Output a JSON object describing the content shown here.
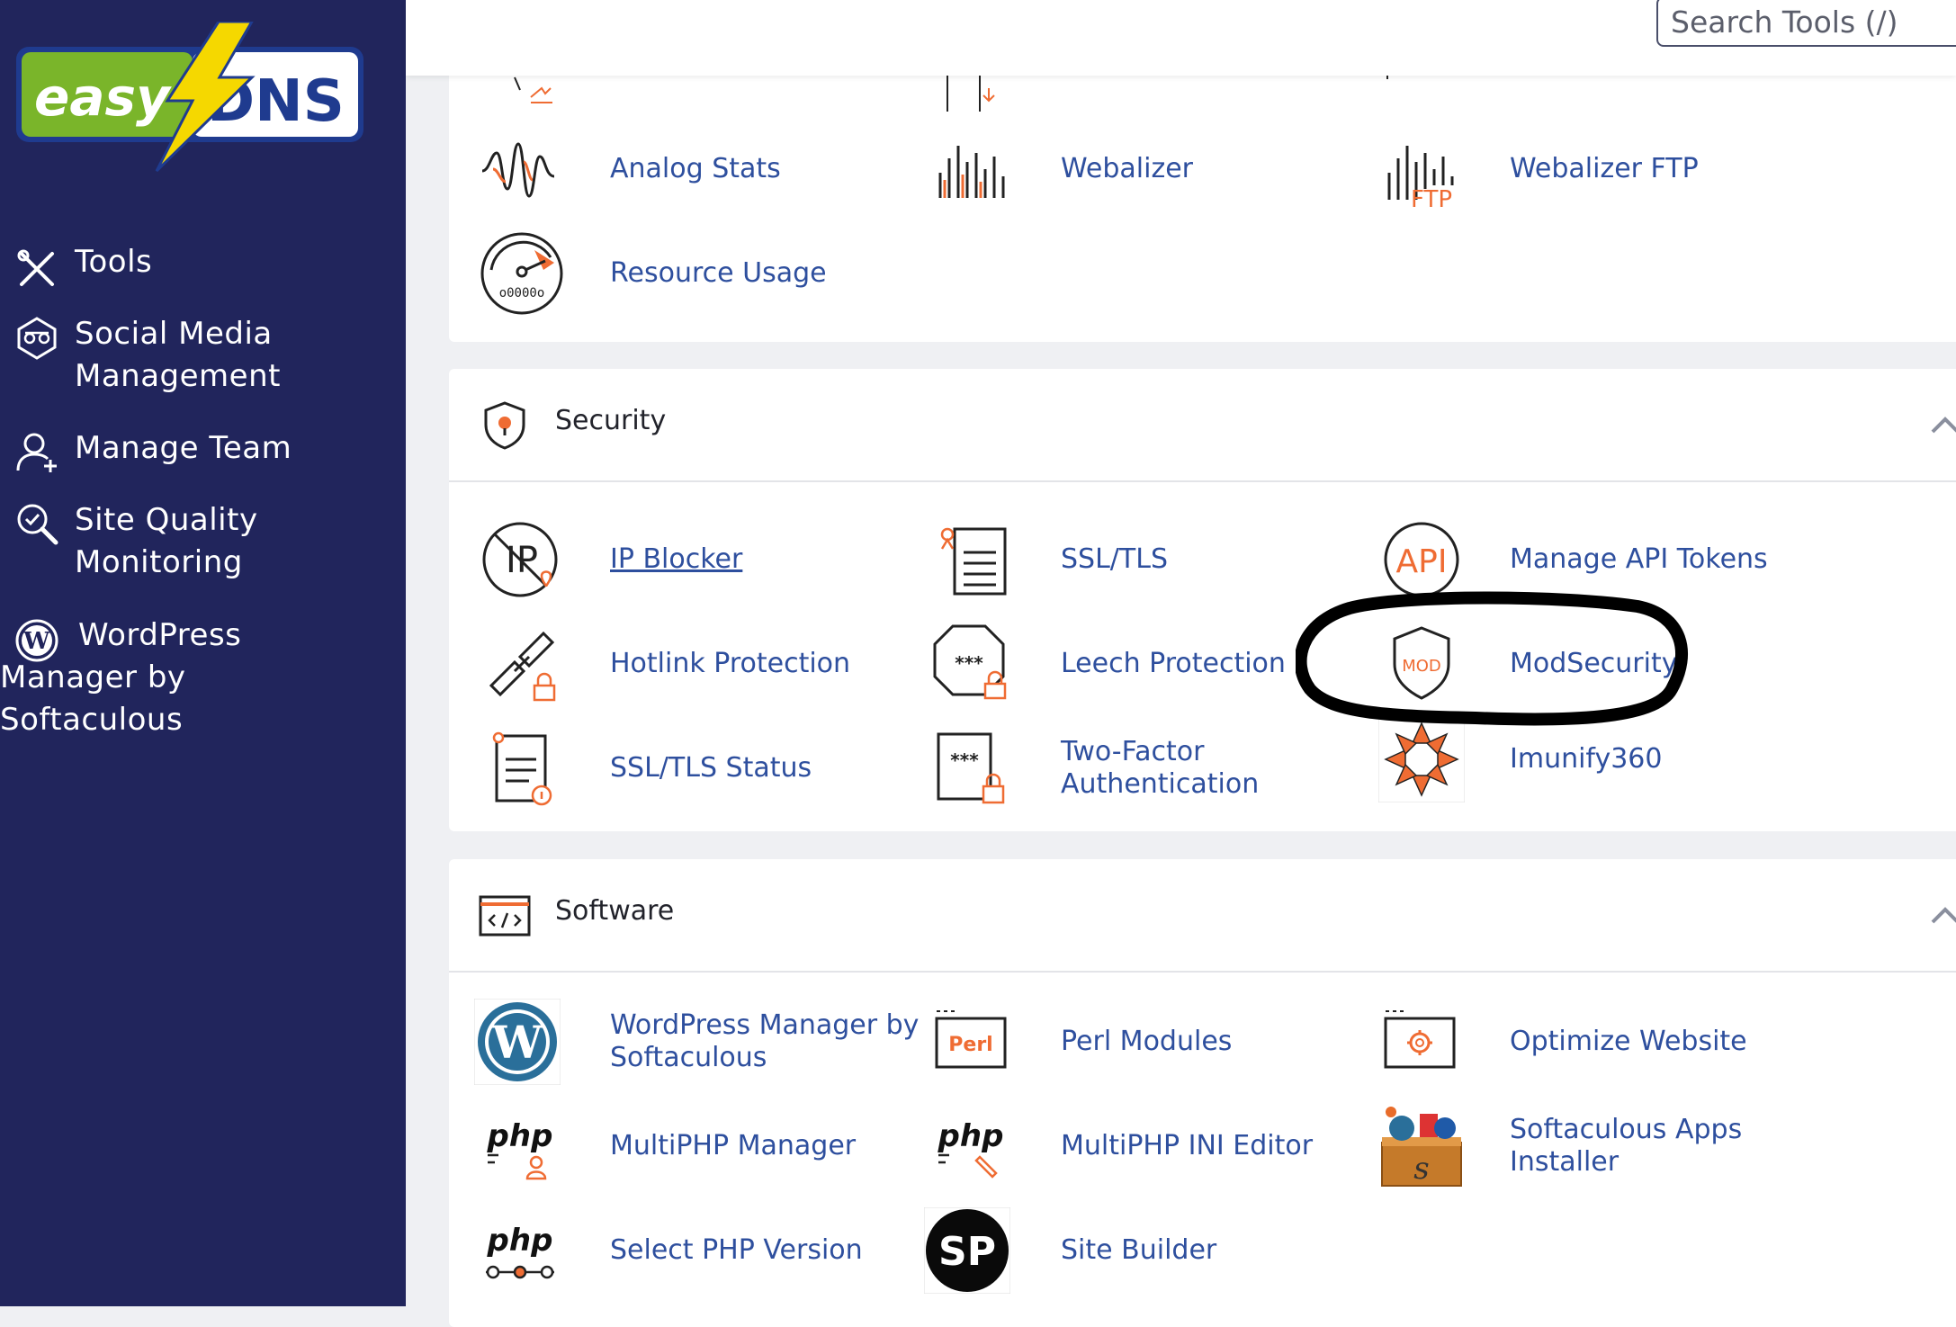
{
  "brand": {
    "logo_left": "easy",
    "logo_right": "DNS"
  },
  "sidebar": {
    "items": [
      {
        "label": "Tools",
        "icon": "tools-icon"
      },
      {
        "label": "Social Media Management",
        "icon": "social-media-icon"
      },
      {
        "label": "Manage Team",
        "icon": "manage-team-icon"
      },
      {
        "label": "Site Quality Monitoring",
        "icon": "site-quality-icon"
      },
      {
        "label": "WordPress Manager by Softaculous",
        "icon": "wordpress-icon"
      }
    ]
  },
  "header": {
    "search_placeholder": "Search Tools (/)"
  },
  "metrics": {
    "tools": [
      {
        "label": "Analog Stats",
        "icon": "analog-stats-icon"
      },
      {
        "label": "Webalizer",
        "icon": "webalizer-icon"
      },
      {
        "label": "Webalizer FTP",
        "icon": "webalizer-ftp-icon",
        "icon_text": "FTP"
      },
      {
        "label": "Resource Usage",
        "icon": "resource-usage-icon",
        "icon_text": "o0000o"
      }
    ]
  },
  "security": {
    "title": "Security",
    "tools": [
      {
        "label": "IP Blocker",
        "icon": "ip-blocker-icon",
        "icon_text": "IP"
      },
      {
        "label": "SSL/TLS",
        "icon": "ssl-tls-icon"
      },
      {
        "label": "Manage API Tokens",
        "icon": "api-icon",
        "icon_text": "API"
      },
      {
        "label": "Hotlink Protection",
        "icon": "hotlink-icon"
      },
      {
        "label": "Leech Protection",
        "icon": "leech-icon",
        "icon_text": "***"
      },
      {
        "label": "ModSecurity",
        "icon": "modsecurity-icon",
        "icon_text": "MOD"
      },
      {
        "label": "SSL/TLS Status",
        "icon": "ssl-status-icon"
      },
      {
        "label": "Two-Factor Authentication",
        "icon": "two-factor-icon",
        "icon_text": "***"
      },
      {
        "label": "Imunify360",
        "icon": "imunify-icon"
      }
    ]
  },
  "software": {
    "title": "Software",
    "tools": [
      {
        "label": "WordPress Manager by Softaculous",
        "icon": "wordpress-icon"
      },
      {
        "label": "Perl Modules",
        "icon": "perl-icon",
        "icon_text": "Perl"
      },
      {
        "label": "Optimize Website",
        "icon": "optimize-icon"
      },
      {
        "label": "MultiPHP Manager",
        "icon": "php-manager-icon",
        "icon_text": "php"
      },
      {
        "label": "MultiPHP INI Editor",
        "icon": "php-ini-icon",
        "icon_text": "php"
      },
      {
        "label": "Softaculous Apps Installer",
        "icon": "softaculous-icon"
      },
      {
        "label": "Select PHP Version",
        "icon": "php-version-icon",
        "icon_text": "php"
      },
      {
        "label": "Site Builder",
        "icon": "site-builder-icon",
        "icon_text": "SP"
      }
    ]
  },
  "colors": {
    "sidebar_bg": "#21255c",
    "link": "#2e4f9e",
    "accent_orange": "#ef6c33",
    "logo_green": "#7ab52a",
    "logo_blue": "#1f3b8f",
    "logo_bolt": "#f5d800"
  }
}
